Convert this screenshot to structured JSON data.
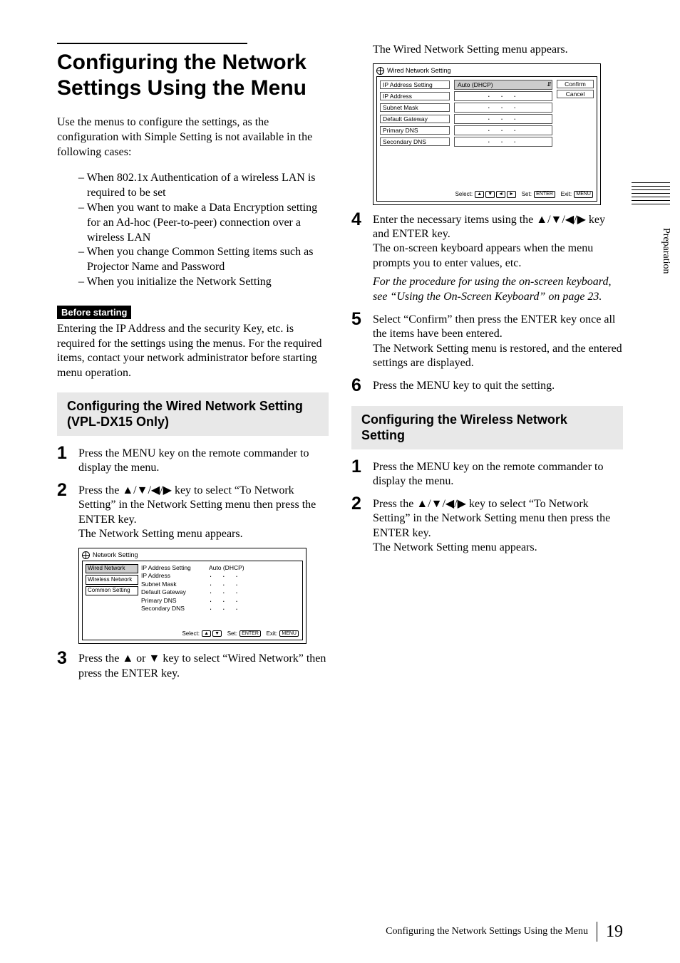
{
  "side_tab": "Preparation",
  "footer_text": "Configuring the Network Settings Using the Menu",
  "page_number": "19",
  "main_title": "Configuring the Network Settings Using the Menu",
  "intro_para": "Use the menus to configure the settings, as the configuration with Simple Setting is not available in the following cases:",
  "intro_bullets": [
    "– When 802.1x Authentication of a wireless LAN is required to be set",
    "– When you want to make a Data Encryption setting for an Ad-hoc (Peer-to-peer) connection over a wireless LAN",
    "– When you change Common Setting items such as Projector Name and Password",
    "– When you initialize the Network Setting"
  ],
  "before_starting_label": "Before starting",
  "before_starting_text": "Entering the IP Address and the security Key, etc. is required for the settings using the menus. For the required items, contact your network administrator before starting menu operation.",
  "wired_heading": "Configuring the Wired Network Setting (VPL-DX15 Only)",
  "wired_steps": {
    "s1": "Press the MENU key on the remote commander to display the menu.",
    "s2a": "Press the ▲/▼/◀/▶ key to select “To Network Setting” in the Network Setting menu then press the ENTER key.",
    "s2b": "The Network Setting menu appears.",
    "s3": "Press the ▲ or ▼ key to select “Wired Network” then press the ENTER key."
  },
  "right_intro": "The Wired Network Setting menu appears.",
  "step4a": "Enter the necessary items using the ▲/▼/◀/▶ key and ENTER key.",
  "step4b": "The on-screen keyboard appears when the menu prompts you to enter values, etc.",
  "step4_note": "For the procedure for using the on-screen keyboard, see “Using the On-Screen Keyboard” on page 23.",
  "step5a": "Select “Confirm” then press the ENTER key once all the items have been entered.",
  "step5b": "The Network Setting menu is restored, and the entered settings are displayed.",
  "step6": "Press the MENU key to quit the setting.",
  "wireless_heading": "Configuring the Wireless Network Setting",
  "wireless_steps": {
    "s1": "Press the MENU key on the remote commander to display the menu.",
    "s2a": "Press the ▲/▼/◀/▶ key to select “To Network Setting” in the Network Setting menu then press the ENTER key.",
    "s2b": "The Network Setting menu appears."
  },
  "menu1": {
    "title": "Network Setting",
    "tabs": [
      "Wired Network",
      "Wireless Network",
      "Common Setting"
    ],
    "fields": [
      {
        "label": "IP Address Setting",
        "value_text": "Auto (DHCP)"
      },
      {
        "label": "IP Address",
        "value": ". . ."
      },
      {
        "label": "Subnet Mask",
        "value": ". . ."
      },
      {
        "label": "Default Gateway",
        "value": ". . ."
      },
      {
        "label": "Primary DNS",
        "value": ". . ."
      },
      {
        "label": "Secondary DNS",
        "value": ". . ."
      }
    ],
    "footer_select": "Select:",
    "footer_set": "Set:",
    "footer_exit": "Exit:",
    "enter_key": "ENTER",
    "menu_key": "MENU"
  },
  "menu2": {
    "title": "Wired Network Setting",
    "rows": [
      {
        "label": "IP Address Setting",
        "value": "Auto (DHCP)",
        "selected": true
      },
      {
        "label": "IP Address",
        "value": ". . ."
      },
      {
        "label": "Subnet Mask",
        "value": ". . ."
      },
      {
        "label": "Default Gateway",
        "value": ". . ."
      },
      {
        "label": "Primary DNS",
        "value": ". . ."
      },
      {
        "label": "Secondary DNS",
        "value": ". . ."
      }
    ],
    "confirm": "Confirm",
    "cancel": "Cancel",
    "footer_select": "Select:",
    "footer_set": "Set:",
    "footer_exit": "Exit:",
    "enter_key": "ENTER",
    "menu_key": "MENU"
  }
}
